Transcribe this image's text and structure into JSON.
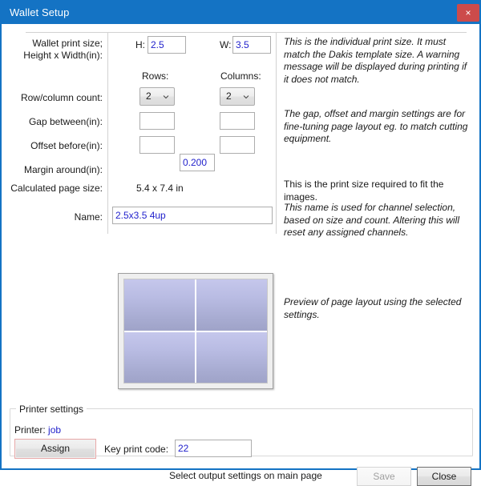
{
  "window": {
    "title": "Wallet Setup",
    "close_label": "×"
  },
  "form": {
    "print_size_label_line1": "Wallet print size;",
    "print_size_label_line2": "Height x Width(in):",
    "height_prefix": "H:",
    "height_value": "2.5",
    "width_prefix": "W:",
    "width_value": "3.5",
    "rows_header": "Rows:",
    "columns_header": "Columns:",
    "rowcol_label": "Row/column count:",
    "rows_value": "2",
    "columns_value": "2",
    "gap_label": "Gap between(in):",
    "gap_rows_value": "",
    "gap_cols_value": "",
    "offset_label": "Offset before(in):",
    "offset_rows_value": "",
    "offset_cols_value": "",
    "margin_label": "Margin around(in):",
    "margin_value": "0.200",
    "calculated_label": "Calculated page size:",
    "calculated_value": "5.4 x 7.4 in",
    "name_label": "Name:",
    "name_value": "2.5x3.5 4up"
  },
  "help": {
    "print_size": "This is the individual print size. It must match the Dakis template size. A warning message will be displayed during printing if it does not match.",
    "gap_offset_margin": "The gap, offset and margin settings are for fine-tuning page layout eg. to match cutting equipment.",
    "calculated": "This is the print size required to fit the images.",
    "name": "This name is used for channel selection, based on size and count. Altering this will reset any assigned channels.",
    "preview": "Preview of page layout using the selected settings."
  },
  "printer": {
    "group_title": "Printer settings",
    "printer_prefix": "Printer:",
    "printer_value": "job",
    "assign_label": "Assign",
    "key_code_label": "Key print code:",
    "key_code_value": "22"
  },
  "footer": {
    "note": "Select output settings on main page",
    "save_label": "Save",
    "close_label": "Close"
  }
}
